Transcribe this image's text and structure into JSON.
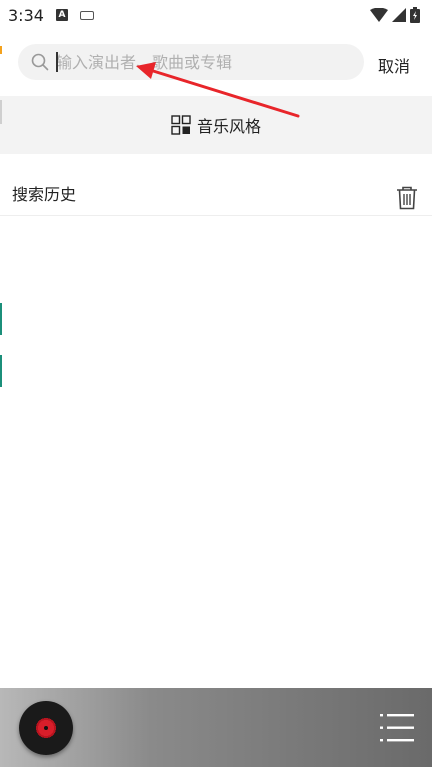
{
  "status_bar": {
    "time": "3:34",
    "notification_letter": "A",
    "icons": [
      "keyboard-icon",
      "wifi-icon",
      "signal-icon",
      "battery-icon"
    ]
  },
  "search": {
    "placeholder": "输入演出者、歌曲或专辑",
    "value": "",
    "cancel_label": "取消",
    "icon": "search-icon"
  },
  "genre": {
    "label": "音乐风格",
    "icon": "grid-icon"
  },
  "history": {
    "title": "搜索历史",
    "icon": "trash-icon"
  },
  "player": {
    "disc_icon": "vinyl-disc-icon",
    "playlist_icon": "playlist-icon"
  },
  "colors": {
    "accent_red": "#e8252a",
    "search_bg": "#f2f2f2",
    "genre_bg": "#f3f3f3",
    "side_mark_teal": "#1b8f7a",
    "side_mark_orange": "#f4a21d"
  }
}
